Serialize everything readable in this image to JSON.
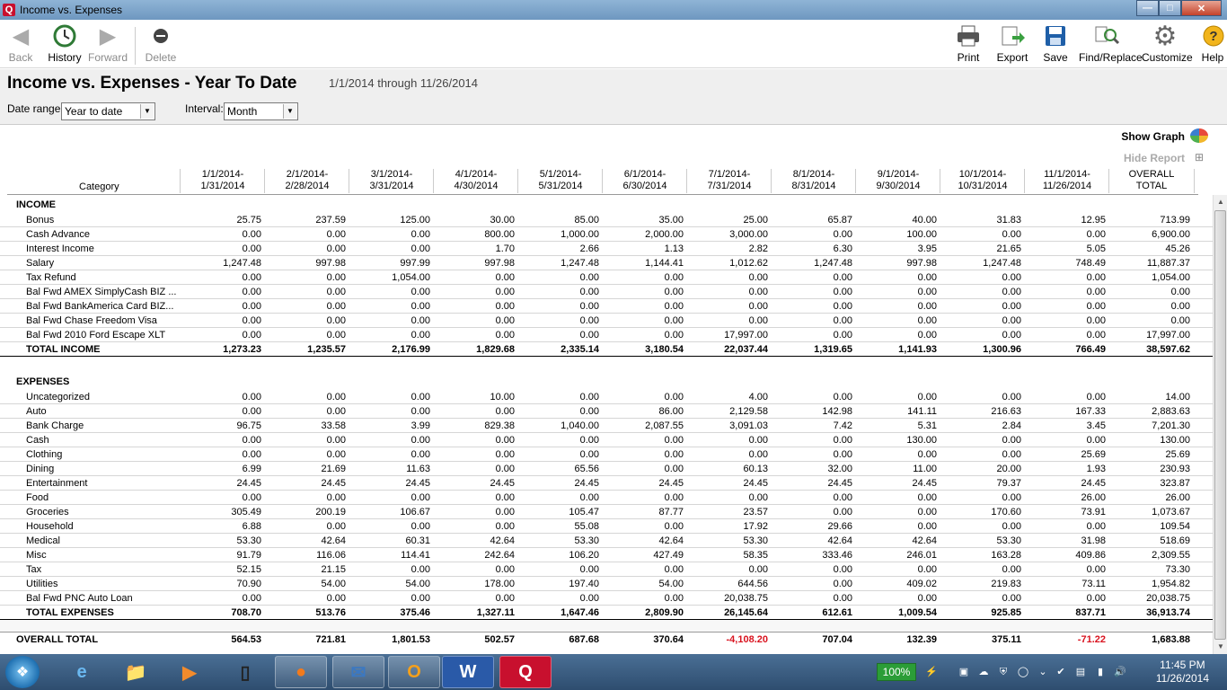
{
  "window": {
    "title": "Income vs. Expenses",
    "app_icon": "Q"
  },
  "toolbar": {
    "back": "Back",
    "history": "History",
    "forward": "Forward",
    "delete": "Delete",
    "print": "Print",
    "export": "Export",
    "save": "Save",
    "find_replace": "Find/Replace",
    "customize": "Customize",
    "help": "Help"
  },
  "report": {
    "title": "Income vs. Expenses - Year To Date",
    "date_span": "1/1/2014 through 11/26/2014",
    "date_range_label": "Date range:",
    "date_range_value": "Year to date",
    "interval_label": "Interval:",
    "interval_value": "Month",
    "show_graph": "Show Graph",
    "hide_report": "Hide Report",
    "category_header": "Category",
    "columns": [
      [
        "1/1/2014-",
        "1/31/2014"
      ],
      [
        "2/1/2014-",
        "2/28/2014"
      ],
      [
        "3/1/2014-",
        "3/31/2014"
      ],
      [
        "4/1/2014-",
        "4/30/2014"
      ],
      [
        "5/1/2014-",
        "5/31/2014"
      ],
      [
        "6/1/2014-",
        "6/30/2014"
      ],
      [
        "7/1/2014-",
        "7/31/2014"
      ],
      [
        "8/1/2014-",
        "8/31/2014"
      ],
      [
        "9/1/2014-",
        "9/30/2014"
      ],
      [
        "10/1/2014-",
        "10/31/2014"
      ],
      [
        "11/1/2014-",
        "11/26/2014"
      ],
      [
        "OVERALL",
        "TOTAL"
      ]
    ],
    "income": {
      "label": "INCOME",
      "rows": [
        {
          "name": "Bonus",
          "values": [
            "25.75",
            "237.59",
            "125.00",
            "30.00",
            "85.00",
            "35.00",
            "25.00",
            "65.87",
            "40.00",
            "31.83",
            "12.95",
            "713.99"
          ]
        },
        {
          "name": "Cash Advance",
          "values": [
            "0.00",
            "0.00",
            "0.00",
            "800.00",
            "1,000.00",
            "2,000.00",
            "3,000.00",
            "0.00",
            "100.00",
            "0.00",
            "0.00",
            "6,900.00"
          ]
        },
        {
          "name": "Interest Income",
          "values": [
            "0.00",
            "0.00",
            "0.00",
            "1.70",
            "2.66",
            "1.13",
            "2.82",
            "6.30",
            "3.95",
            "21.65",
            "5.05",
            "45.26"
          ]
        },
        {
          "name": "Salary",
          "values": [
            "1,247.48",
            "997.98",
            "997.99",
            "997.98",
            "1,247.48",
            "1,144.41",
            "1,012.62",
            "1,247.48",
            "997.98",
            "1,247.48",
            "748.49",
            "11,887.37"
          ]
        },
        {
          "name": "Tax Refund",
          "values": [
            "0.00",
            "0.00",
            "1,054.00",
            "0.00",
            "0.00",
            "0.00",
            "0.00",
            "0.00",
            "0.00",
            "0.00",
            "0.00",
            "1,054.00"
          ]
        },
        {
          "name": "Bal Fwd AMEX SimplyCash BIZ ...",
          "values": [
            "0.00",
            "0.00",
            "0.00",
            "0.00",
            "0.00",
            "0.00",
            "0.00",
            "0.00",
            "0.00",
            "0.00",
            "0.00",
            "0.00"
          ]
        },
        {
          "name": "Bal Fwd BankAmerica Card BIZ...",
          "values": [
            "0.00",
            "0.00",
            "0.00",
            "0.00",
            "0.00",
            "0.00",
            "0.00",
            "0.00",
            "0.00",
            "0.00",
            "0.00",
            "0.00"
          ]
        },
        {
          "name": "Bal Fwd Chase Freedom Visa",
          "values": [
            "0.00",
            "0.00",
            "0.00",
            "0.00",
            "0.00",
            "0.00",
            "0.00",
            "0.00",
            "0.00",
            "0.00",
            "0.00",
            "0.00"
          ]
        },
        {
          "name": "Bal Fwd 2010 Ford Escape XLT",
          "values": [
            "0.00",
            "0.00",
            "0.00",
            "0.00",
            "0.00",
            "0.00",
            "17,997.00",
            "0.00",
            "0.00",
            "0.00",
            "0.00",
            "17,997.00"
          ]
        }
      ],
      "total": {
        "name": "TOTAL INCOME",
        "values": [
          "1,273.23",
          "1,235.57",
          "2,176.99",
          "1,829.68",
          "2,335.14",
          "3,180.54",
          "22,037.44",
          "1,319.65",
          "1,141.93",
          "1,300.96",
          "766.49",
          "38,597.62"
        ]
      }
    },
    "expenses": {
      "label": "EXPENSES",
      "rows": [
        {
          "name": "Uncategorized",
          "values": [
            "0.00",
            "0.00",
            "0.00",
            "10.00",
            "0.00",
            "0.00",
            "4.00",
            "0.00",
            "0.00",
            "0.00",
            "0.00",
            "14.00"
          ]
        },
        {
          "name": "Auto",
          "values": [
            "0.00",
            "0.00",
            "0.00",
            "0.00",
            "0.00",
            "86.00",
            "2,129.58",
            "142.98",
            "141.11",
            "216.63",
            "167.33",
            "2,883.63"
          ]
        },
        {
          "name": "Bank Charge",
          "values": [
            "96.75",
            "33.58",
            "3.99",
            "829.38",
            "1,040.00",
            "2,087.55",
            "3,091.03",
            "7.42",
            "5.31",
            "2.84",
            "3.45",
            "7,201.30"
          ]
        },
        {
          "name": "Cash",
          "values": [
            "0.00",
            "0.00",
            "0.00",
            "0.00",
            "0.00",
            "0.00",
            "0.00",
            "0.00",
            "130.00",
            "0.00",
            "0.00",
            "130.00"
          ]
        },
        {
          "name": "Clothing",
          "values": [
            "0.00",
            "0.00",
            "0.00",
            "0.00",
            "0.00",
            "0.00",
            "0.00",
            "0.00",
            "0.00",
            "0.00",
            "25.69",
            "25.69"
          ]
        },
        {
          "name": "Dining",
          "values": [
            "6.99",
            "21.69",
            "11.63",
            "0.00",
            "65.56",
            "0.00",
            "60.13",
            "32.00",
            "11.00",
            "20.00",
            "1.93",
            "230.93"
          ]
        },
        {
          "name": "Entertainment",
          "values": [
            "24.45",
            "24.45",
            "24.45",
            "24.45",
            "24.45",
            "24.45",
            "24.45",
            "24.45",
            "24.45",
            "79.37",
            "24.45",
            "323.87"
          ]
        },
        {
          "name": "Food",
          "values": [
            "0.00",
            "0.00",
            "0.00",
            "0.00",
            "0.00",
            "0.00",
            "0.00",
            "0.00",
            "0.00",
            "0.00",
            "26.00",
            "26.00"
          ]
        },
        {
          "name": "Groceries",
          "values": [
            "305.49",
            "200.19",
            "106.67",
            "0.00",
            "105.47",
            "87.77",
            "23.57",
            "0.00",
            "0.00",
            "170.60",
            "73.91",
            "1,073.67"
          ]
        },
        {
          "name": "Household",
          "values": [
            "6.88",
            "0.00",
            "0.00",
            "0.00",
            "55.08",
            "0.00",
            "17.92",
            "29.66",
            "0.00",
            "0.00",
            "0.00",
            "109.54"
          ]
        },
        {
          "name": "Medical",
          "values": [
            "53.30",
            "42.64",
            "60.31",
            "42.64",
            "53.30",
            "42.64",
            "53.30",
            "42.64",
            "42.64",
            "53.30",
            "31.98",
            "518.69"
          ]
        },
        {
          "name": "Misc",
          "values": [
            "91.79",
            "116.06",
            "114.41",
            "242.64",
            "106.20",
            "427.49",
            "58.35",
            "333.46",
            "246.01",
            "163.28",
            "409.86",
            "2,309.55"
          ]
        },
        {
          "name": "Tax",
          "values": [
            "52.15",
            "21.15",
            "0.00",
            "0.00",
            "0.00",
            "0.00",
            "0.00",
            "0.00",
            "0.00",
            "0.00",
            "0.00",
            "73.30"
          ]
        },
        {
          "name": "Utilities",
          "values": [
            "70.90",
            "54.00",
            "54.00",
            "178.00",
            "197.40",
            "54.00",
            "644.56",
            "0.00",
            "409.02",
            "219.83",
            "73.11",
            "1,954.82"
          ]
        },
        {
          "name": "Bal Fwd PNC Auto Loan",
          "values": [
            "0.00",
            "0.00",
            "0.00",
            "0.00",
            "0.00",
            "0.00",
            "20,038.75",
            "0.00",
            "0.00",
            "0.00",
            "0.00",
            "20,038.75"
          ]
        }
      ],
      "total": {
        "name": "TOTAL EXPENSES",
        "values": [
          "708.70",
          "513.76",
          "375.46",
          "1,327.11",
          "1,647.46",
          "2,809.90",
          "26,145.64",
          "612.61",
          "1,009.54",
          "925.85",
          "837.71",
          "36,913.74"
        ]
      }
    },
    "overall": {
      "name": "OVERALL TOTAL",
      "values": [
        "564.53",
        "721.81",
        "1,801.53",
        "502.57",
        "687.68",
        "370.64",
        "-4,108.20",
        "707.04",
        "132.39",
        "375.11",
        "-71.22",
        "1,683.88"
      ]
    },
    "negative_color": "#d9131f"
  },
  "taskbar": {
    "battery": "100%",
    "time": "11:45 PM",
    "date": "11/26/2014",
    "apps": [
      "internet-explorer",
      "file-explorer",
      "media-player",
      "laptop",
      "firefox",
      "thunderbird",
      "outlook",
      "word",
      "quicken"
    ]
  }
}
